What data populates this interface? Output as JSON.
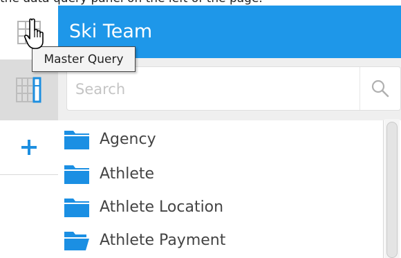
{
  "top_text": "the data query panel on the left of the page.",
  "header": {
    "title": "Ski Team"
  },
  "rail": {
    "master_query_icon": "grid-icon",
    "query_icon": "query-column-icon",
    "add_icon": "plus-icon"
  },
  "tooltip": {
    "text": "Master Query"
  },
  "search": {
    "placeholder": "Search",
    "value": ""
  },
  "list": {
    "items": [
      {
        "label": "Agency",
        "icon": "folder-icon",
        "state": "closed"
      },
      {
        "label": "Athlete",
        "icon": "folder-icon",
        "state": "closed"
      },
      {
        "label": "Athlete Location",
        "icon": "folder-icon",
        "state": "closed"
      },
      {
        "label": "Athlete Payment",
        "icon": "folder-icon",
        "state": "open"
      }
    ]
  },
  "colors": {
    "header_bg": "#1e97e9",
    "accent": "#1e8fe0",
    "folder": "#1b8fe3",
    "rail_selected_bg": "#dcdcdc"
  }
}
